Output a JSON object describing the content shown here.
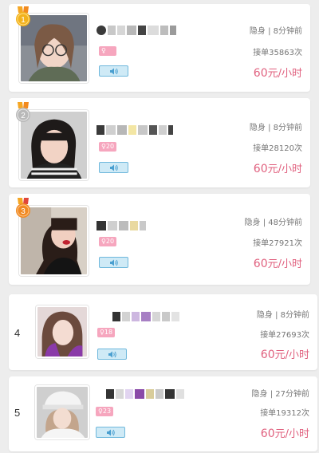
{
  "colors": {
    "price": "#e0607e",
    "age_badge": "#f6a6be",
    "voice_button": "#cfeaf6",
    "gold": "#f2b21c",
    "silver": "#b9b9b9",
    "bronze": "#f08a24"
  },
  "rankings": [
    {
      "rank": "1",
      "medal": "gold",
      "status": "隐身 | 8分钟前",
      "orders": "接单35863次",
      "price_value": "60",
      "price_unit": "元/小时",
      "age": "",
      "voice_icon": "speaker-icon"
    },
    {
      "rank": "2",
      "medal": "silver",
      "status": "隐身 | 8分钟前",
      "orders": "接单28120次",
      "price_value": "60",
      "price_unit": "元/小时",
      "age": "20",
      "voice_icon": "speaker-icon"
    },
    {
      "rank": "3",
      "medal": "bronze",
      "status": "隐身 | 48分钟前",
      "orders": "接单27921次",
      "price_value": "60",
      "price_unit": "元/小时",
      "age": "20",
      "voice_icon": "speaker-icon"
    },
    {
      "rank": "4",
      "medal": "",
      "status": "隐身 | 8分钟前",
      "orders": "接单27693次",
      "price_value": "60",
      "price_unit": "元/小时",
      "age": "18",
      "voice_icon": "speaker-icon"
    },
    {
      "rank": "5",
      "medal": "",
      "status": "隐身 | 27分钟前",
      "orders": "接单19312次",
      "price_value": "60",
      "price_unit": "元/小时",
      "age": "23",
      "voice_icon": "speaker-icon"
    }
  ]
}
